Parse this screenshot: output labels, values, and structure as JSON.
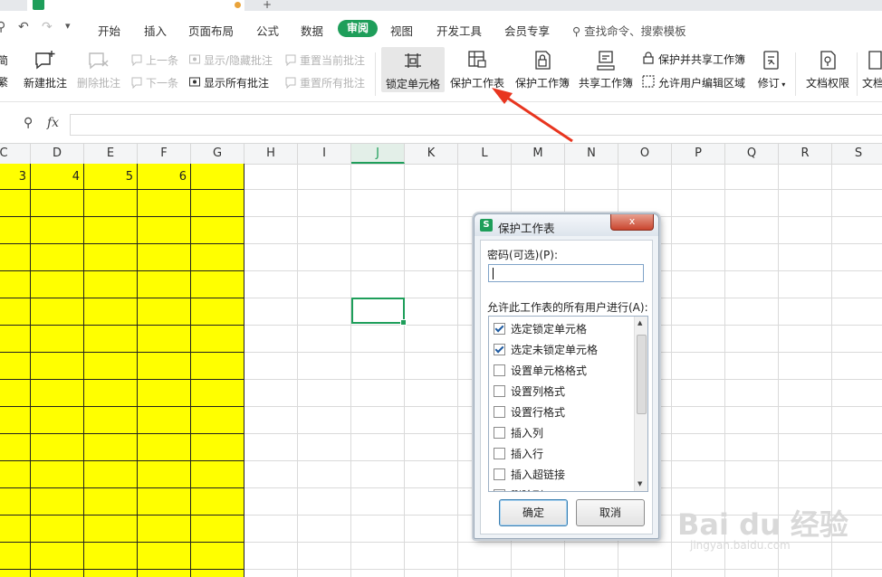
{
  "menubar": {
    "items": [
      "开始",
      "插入",
      "页面布局",
      "公式",
      "数据",
      "审阅",
      "视图",
      "开发工具",
      "会员专享"
    ],
    "active": "审阅",
    "search": "查找命令、搜索模板"
  },
  "ribbon": {
    "new_comment": "新建批注",
    "delete_comment": "删除批注",
    "prev": "上一条",
    "next": "下一条",
    "show_hide_comment": "显示/隐藏批注",
    "show_all_comments": "显示所有批注",
    "reset_current": "重置当前批注",
    "reset_all": "重置所有批注",
    "lock_cells": "锁定单元格",
    "protect_sheet": "保护工作表",
    "protect_book": "保护工作簿",
    "share_book": "共享工作簿",
    "protect_share": "保护并共享工作簿",
    "allow_edit_ranges": "允许用户编辑区域",
    "revise": "修订",
    "doc_rights": "文档权限",
    "doc_more": "文档",
    "left_edge_1": "简",
    "left_edge_2": "繁"
  },
  "formula": {
    "fx": "fx"
  },
  "columns": [
    "C",
    "D",
    "E",
    "F",
    "G",
    "H",
    "I",
    "J",
    "K",
    "L",
    "M",
    "N",
    "O",
    "P",
    "Q",
    "R",
    "S"
  ],
  "selected_column": "J",
  "row1_values": [
    "3",
    "4",
    "5",
    "6"
  ],
  "dialog": {
    "title": "保护工作表",
    "logo": "S",
    "close": "x",
    "password_label": "密码(可选)(P):",
    "permissions_label": "允许此工作表的所有用户进行(A):",
    "permissions": [
      {
        "label": "选定锁定单元格",
        "checked": true
      },
      {
        "label": "选定未锁定单元格",
        "checked": true
      },
      {
        "label": "设置单元格格式",
        "checked": false
      },
      {
        "label": "设置列格式",
        "checked": false
      },
      {
        "label": "设置行格式",
        "checked": false
      },
      {
        "label": "插入列",
        "checked": false
      },
      {
        "label": "插入行",
        "checked": false
      },
      {
        "label": "插入超链接",
        "checked": false
      },
      {
        "label": "删除列",
        "checked": false
      }
    ],
    "ok": "确定",
    "cancel": "取消"
  },
  "watermark": {
    "text": "Bai du 经验",
    "url": "jingyan.baidu.com"
  },
  "colors": {
    "accent": "#1e9e5a",
    "cell_fill": "#ffff00",
    "arrow": "#e8351f"
  }
}
